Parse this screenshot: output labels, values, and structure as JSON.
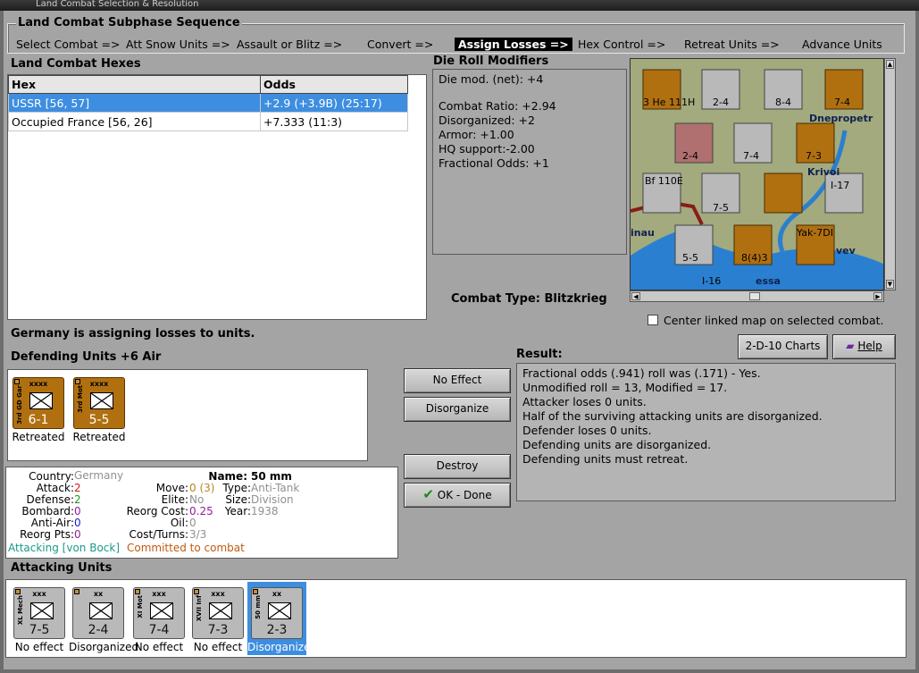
{
  "window": {
    "title": "Land Combat Selection & Resolution"
  },
  "sequence": {
    "title": "Land Combat Subphase Sequence",
    "items": [
      {
        "label": "Select Combat =>",
        "active": false
      },
      {
        "label": "Att Snow Units =>",
        "active": false
      },
      {
        "label": "Assault or Blitz =>",
        "active": false
      },
      {
        "label": "Convert =>",
        "active": false
      },
      {
        "label": "Assign Losses =>",
        "active": true
      },
      {
        "label": "Hex Control =>",
        "active": false
      },
      {
        "label": "Retreat Units =>",
        "active": false
      },
      {
        "label": "Advance Units",
        "active": false
      }
    ]
  },
  "hexes": {
    "title": "Land Combat Hexes",
    "columns": [
      "Hex",
      "Odds"
    ],
    "rows": [
      {
        "hex": "USSR [56, 57]",
        "odds": "+2.9 (+3.9B) (25:17)",
        "selected": true
      },
      {
        "hex": "Occupied France [56, 26]",
        "odds": "+7.333 (11:3)",
        "selected": false
      }
    ]
  },
  "drm": {
    "title": "Die Roll Modifiers",
    "net": "Die mod. (net): +4",
    "lines": [
      "Combat Ratio: +2.94",
      "Disorganized: +2",
      "Armor: +1.00",
      "HQ support:-2.00",
      "Fractional Odds: +1"
    ]
  },
  "combat_type": "Combat Type:  Blitzkrieg",
  "center_map": {
    "label": "Center linked map on selected combat.",
    "checked": false
  },
  "status": "Germany is assigning losses to units.",
  "defending": {
    "title": "Defending Units +6 Air",
    "units": [
      {
        "size": "xxxx",
        "side": "3rd GD Gar",
        "vals": "6-1",
        "status": "Retreated"
      },
      {
        "size": "xxxx",
        "side": "3rd Mot",
        "vals": "5-5",
        "status": "Retreated"
      }
    ]
  },
  "buttons": {
    "no_effect": "No Effect",
    "disorganize": "Disorganize",
    "destroy": "Destroy",
    "ok_done": "OK - Done",
    "charts": "2-D-10 Charts",
    "help": "Help"
  },
  "result": {
    "title": "Result:",
    "lines": [
      "Fractional odds (.941) roll was (.171)  - Yes.",
      "Unmodified roll = 13, Modified = 17.",
      "Attacker loses 0 units.",
      "Half of the surviving attacking units are disorganized.",
      "Defender loses 0 units.",
      "Defending units are disorganized.",
      "Defending units must retreat."
    ]
  },
  "unit_info": {
    "country_k": "Country:",
    "country_v": "Germany",
    "name_k": "Name:",
    "name_v": "50 mm",
    "attack_k": "Attack:",
    "attack_v": "2",
    "move_k": "Move:",
    "move_v": "0 (3)",
    "type_k": "Type:",
    "type_v": "Anti-Tank",
    "defense_k": "Defense:",
    "defense_v": "2",
    "elite_k": "Elite:",
    "elite_v": "No",
    "size_k": "Size:",
    "size_v": "Division",
    "bombard_k": "Bombard:",
    "bombard_v": "0",
    "reorg_k": "Reorg Cost:",
    "reorg_v": "0.25",
    "year_k": "Year:",
    "year_v": "1938",
    "aa_k": "Anti-Air:",
    "aa_v": "0",
    "oil_k": "Oil:",
    "oil_v": "0",
    "rp_k": "Reorg Pts:",
    "rp_v": "0",
    "ct_k": "Cost/Turns:",
    "ct_v": "3/3",
    "attacking": "Attacking [von Bock]",
    "committed": "Committed to combat"
  },
  "attacking": {
    "title": "Attacking Units",
    "units": [
      {
        "size": "xxx",
        "side": "XL Mech",
        "vals": "7-5",
        "status": "No effect"
      },
      {
        "size": "xx",
        "side": "",
        "vals": "2-4",
        "status": "Disorganized"
      },
      {
        "size": "xxx",
        "side": "XI Mot",
        "vals": "7-4",
        "status": "No effect"
      },
      {
        "size": "xxx",
        "side": "XVII Inf",
        "vals": "7-3",
        "status": "No effect"
      },
      {
        "size": "xx",
        "side": "50 mm",
        "vals": "2-3",
        "status": "Disorganized"
      }
    ]
  },
  "map": {
    "labels": [
      "3 He 111H",
      "2-4",
      "8-4",
      "7-4",
      "Dnepropetr",
      "2-4",
      "7-4",
      "7-3",
      "Bf 110E",
      "7-5",
      "I-17",
      "Krivoi",
      "5-5",
      "8(4)3",
      "Yak-7DI",
      "vev",
      "inau",
      "essa",
      "I-16"
    ]
  },
  "colors": {
    "accent": "#3d8ee0",
    "brown_unit": "#b07010",
    "gray_unit": "#b9b9b9"
  }
}
